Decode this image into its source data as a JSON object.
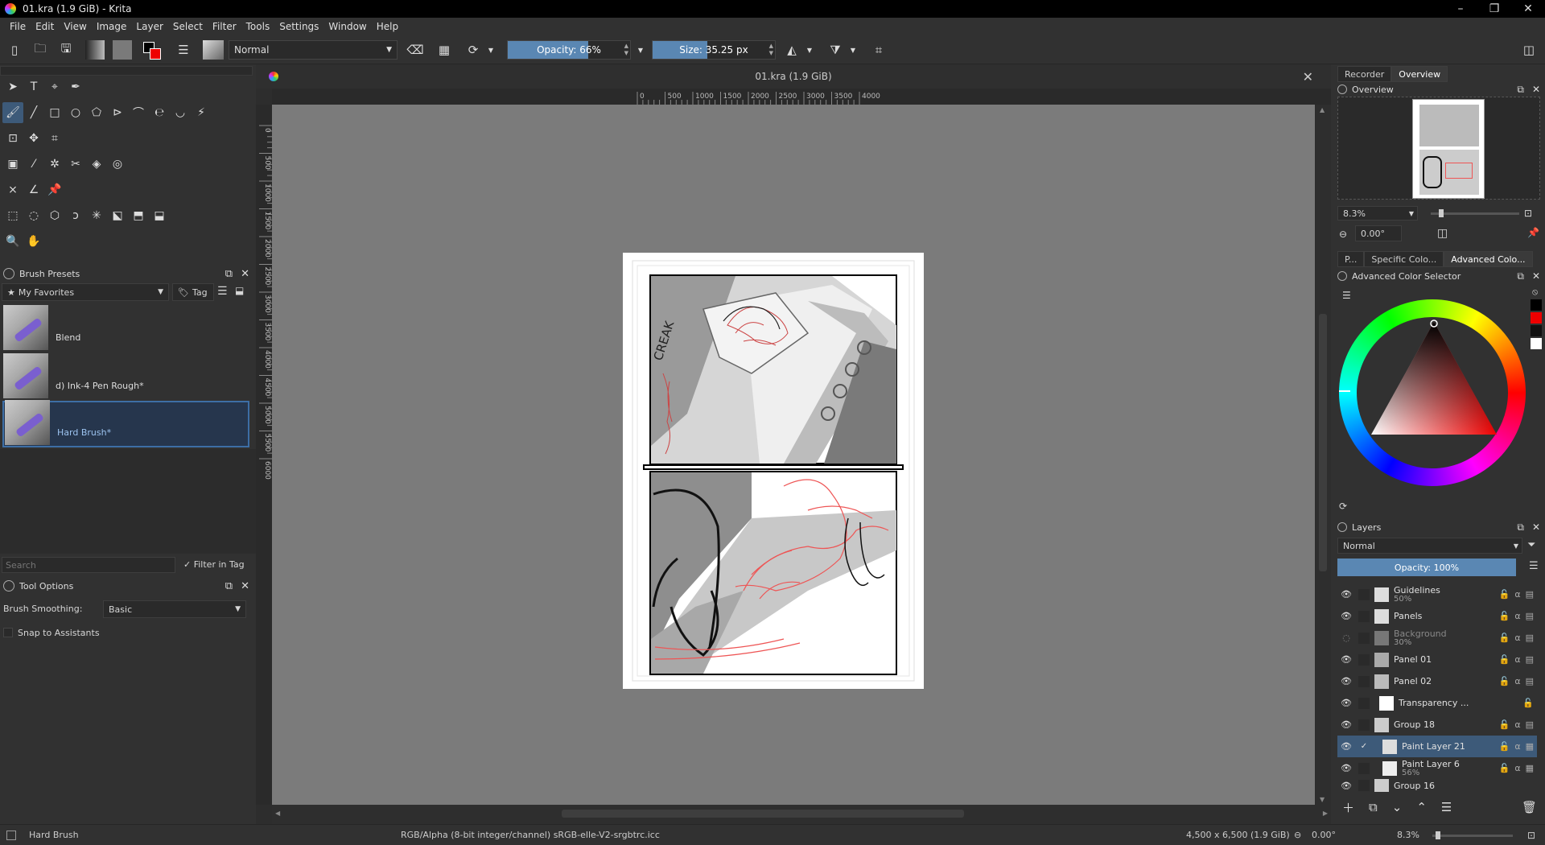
{
  "window": {
    "title": "01.kra (1.9 GiB) - Krita",
    "minimize": "–",
    "maximize": "❐",
    "close": "✕"
  },
  "menu": [
    "File",
    "Edit",
    "View",
    "Image",
    "Layer",
    "Select",
    "Filter",
    "Tools",
    "Settings",
    "Window",
    "Help"
  ],
  "toolbar": {
    "blend_mode": "Normal",
    "opacity_label": "Opacity: 66%",
    "opacity_value": 0.66,
    "size_label": "Size: 35.25 px",
    "size_fraction": 0.45
  },
  "brush_presets": {
    "title": "Brush Presets",
    "tag": "My Favorites",
    "tag_button": "Tag",
    "items": [
      {
        "name": "Blend"
      },
      {
        "name": "d) Ink-4 Pen Rough*"
      },
      {
        "name": "Hard Brush*"
      }
    ],
    "search_placeholder": "Search",
    "filter_in_tag": "Filter in Tag"
  },
  "tool_options": {
    "title": "Tool Options",
    "smoothing_label": "Brush Smoothing:",
    "smoothing_value": "Basic",
    "snap_label": "Snap to Assistants"
  },
  "document": {
    "tab_title": "01.kra (1.9 GiB)",
    "hruler_ticks": [
      "0",
      "500",
      "1000",
      "1500",
      "2000",
      "2500",
      "3000",
      "3500",
      "4000"
    ],
    "vruler_ticks": [
      "0",
      "500",
      "1000",
      "1500",
      "2000",
      "2500",
      "3000",
      "3500",
      "4000",
      "4500",
      "5000",
      "5500",
      "6000"
    ],
    "sfx_text": "CREAK"
  },
  "right_tabs": {
    "recorder": "Recorder",
    "overview": "Overview"
  },
  "overview": {
    "title": "Overview",
    "zoom": "8.3%",
    "rotation": "0.00°"
  },
  "color_tabs": {
    "p": "P...",
    "specific": "Specific Colo...",
    "advanced": "Advanced Colo..."
  },
  "color_selector": {
    "title": "Advanced Color Selector"
  },
  "layers": {
    "title": "Layers",
    "blend_mode": "Normal",
    "opacity_label": "Opacity:  100%",
    "items": [
      {
        "name": "Guidelines",
        "sub": "50%"
      },
      {
        "name": "Panels",
        "sub": ""
      },
      {
        "name": "Background",
        "sub": "30%"
      },
      {
        "name": "Panel 01",
        "sub": ""
      },
      {
        "name": "Panel 02",
        "sub": ""
      },
      {
        "name": "Transparency ...",
        "sub": ""
      },
      {
        "name": "Group 18",
        "sub": ""
      },
      {
        "name": "Paint Layer 21",
        "sub": ""
      },
      {
        "name": "Paint Layer 6",
        "sub": "56%"
      },
      {
        "name": "Group 16",
        "sub": ""
      }
    ]
  },
  "status": {
    "brush": "Hard Brush",
    "color_profile": "RGB/Alpha (8-bit integer/channel)  sRGB-elle-V2-srgbtrc.icc",
    "dimensions": "4,500 x 6,500 (1.9 GiB)",
    "rotation": "0.00°",
    "zoom": "8.3%"
  }
}
